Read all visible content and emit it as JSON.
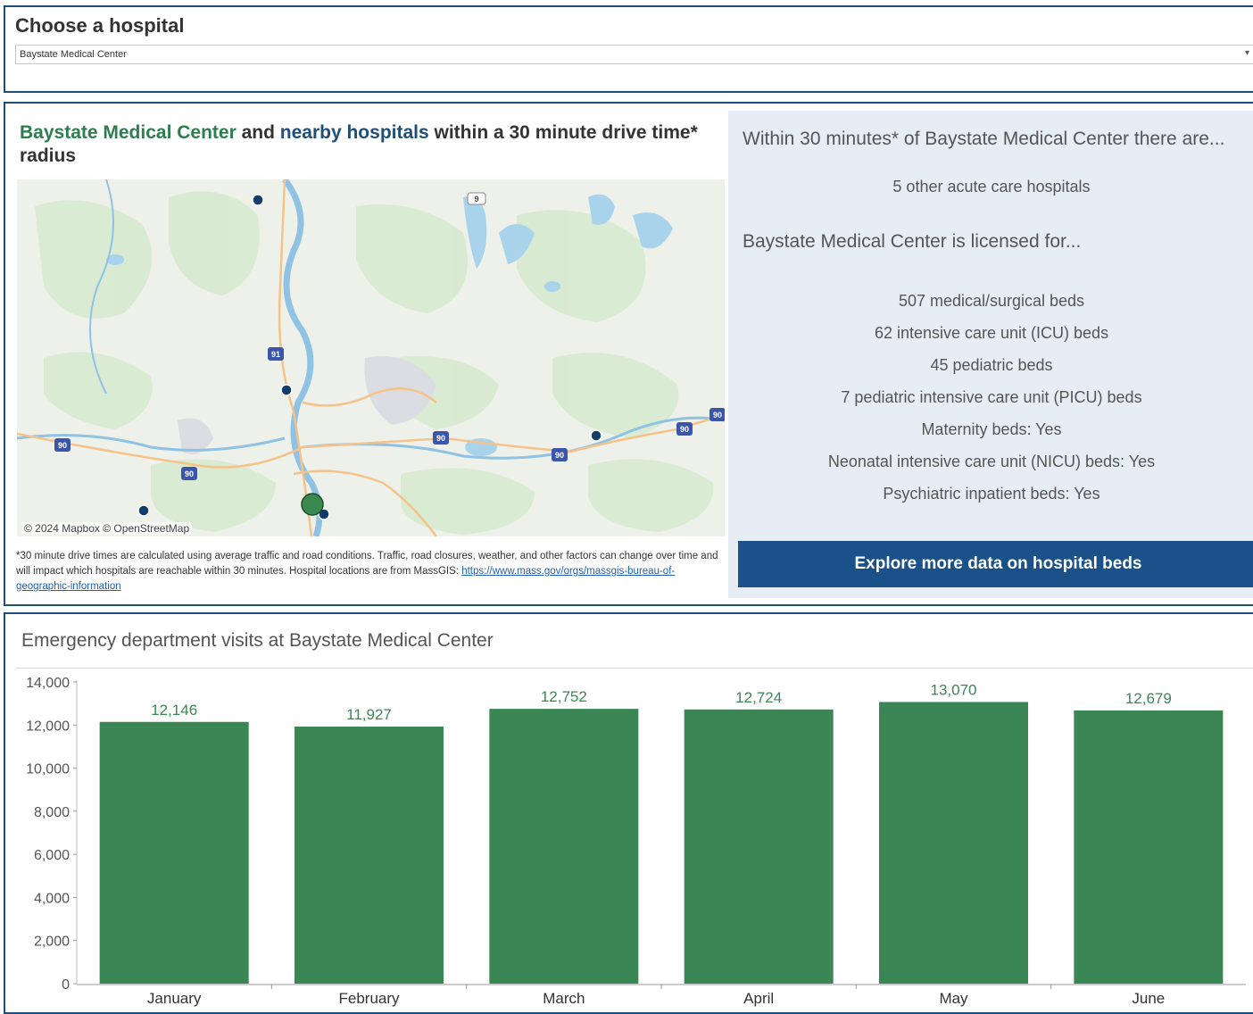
{
  "selector": {
    "title": "Choose a hospital",
    "selected": "Baystate Medical Center"
  },
  "map_panel": {
    "title_hospital": "Baystate Medical Center",
    "title_and": " and ",
    "title_nearby": "nearby hospitals",
    "title_rest": " within a 30 minute drive time* radius",
    "attribution": "© 2024 Mapbox  © OpenStreetMap",
    "highway_labels": [
      "91",
      "90",
      "90",
      "90",
      "90",
      "90",
      "90",
      "9"
    ],
    "note": "*30 minute drive times are calculated using average traffic and road conditions. Traffic, road closures, weather, and other factors can change over time and will impact which hospitals are reachable within 30 minutes. Hospital locations are from MassGIS: ",
    "note_link": "https://www.mass.gov/orgs/massgis-bureau-of-geographic-information"
  },
  "info": {
    "heading": "Within 30 minutes* of Baystate Medical Center there are...",
    "other_hospitals": "5 other acute care hospitals",
    "licensed_heading": "Baystate Medical Center is licensed for...",
    "beds": [
      "507 medical/surgical beds",
      "62 intensive care unit (ICU) beds",
      "45 pediatric beds",
      "7 pediatric intensive care unit (PICU) beds",
      "Maternity beds: Yes",
      "Neonatal intensive care unit (NICU) beds: Yes",
      "Psychiatric inpatient beds: Yes"
    ],
    "button": "Explore more data on hospital beds"
  },
  "ed_panel": {
    "title": "Emergency department visits at Baystate Medical Center"
  },
  "colors": {
    "border": "#1f4e79",
    "bar": "#3a8755",
    "bar_label": "#3a8755",
    "button": "#1a5189",
    "info_bg": "#e6edf5",
    "hospital_selected": "#3a8a50",
    "hospital_other": "#123d6b"
  },
  "chart_data": {
    "type": "bar",
    "title": "Emergency department visits at Baystate Medical Center",
    "xlabel": "",
    "ylabel": "",
    "categories": [
      "January",
      "February",
      "March",
      "April",
      "May",
      "June"
    ],
    "values": [
      12146,
      11927,
      12752,
      12724,
      13070,
      12679
    ],
    "value_labels": [
      "12,146",
      "11,927",
      "12,752",
      "12,724",
      "13,070",
      "12,679"
    ],
    "ylim": [
      0,
      14000
    ],
    "yticks": [
      0,
      2000,
      4000,
      6000,
      8000,
      10000,
      12000,
      14000
    ],
    "ytick_labels": [
      "0",
      "2,000",
      "4,000",
      "6,000",
      "8,000",
      "10,000",
      "12,000",
      "14,000"
    ],
    "grid": false,
    "legend": "none"
  }
}
